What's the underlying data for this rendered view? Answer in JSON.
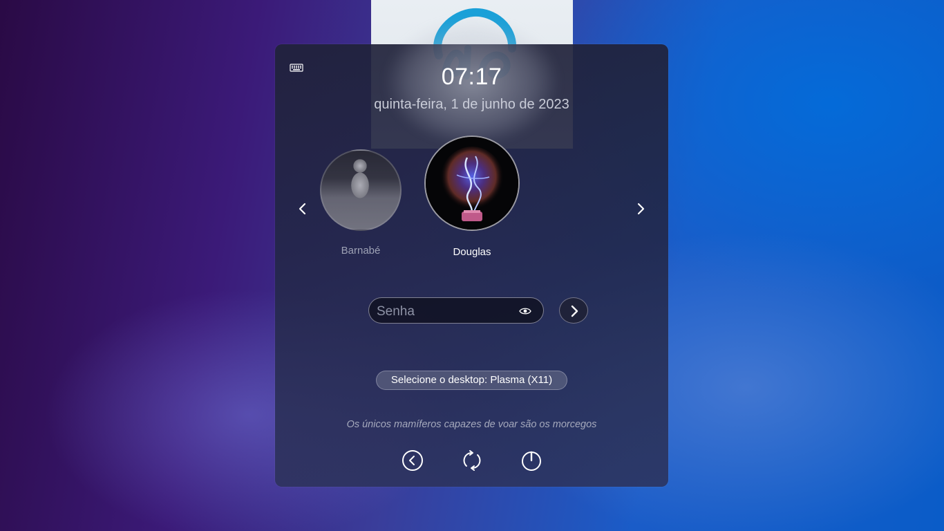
{
  "clock": {
    "time": "07:17",
    "date": "quinta-feira, 1 de junho de 2023"
  },
  "users": [
    {
      "name": "Barnabé",
      "selected": false,
      "avatar_icon": "astronaut-avatar"
    },
    {
      "name": "Douglas",
      "selected": true,
      "avatar_icon": "plasma-bulb-avatar"
    }
  ],
  "password": {
    "placeholder": "Senha",
    "value": ""
  },
  "session": {
    "label": "Selecione o desktop: Plasma (X11)"
  },
  "tip": "Os únicos mamíferos capazes de voar são os morcegos",
  "actions": {
    "back_icon": "back-icon",
    "restart_icon": "restart-icon",
    "power_icon": "power-icon"
  },
  "colors": {
    "logo_blue": "#1aa0d8",
    "panel_bg": "#20223a",
    "text_primary": "#ffffff",
    "text_muted": "#a5a9bc"
  }
}
